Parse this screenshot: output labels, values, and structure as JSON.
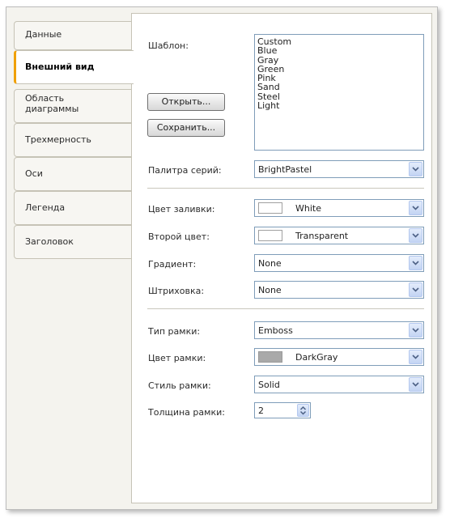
{
  "tabs": [
    {
      "label": "Данные"
    },
    {
      "label": "Внешний вид"
    },
    {
      "label": "Область диаграммы"
    },
    {
      "label": "Трехмерность"
    },
    {
      "label": "Оси"
    },
    {
      "label": "Легенда"
    },
    {
      "label": "Заголовок"
    }
  ],
  "active_tab": "Внешний вид",
  "template": {
    "label": "Шаблон:",
    "items": [
      "Custom",
      "Blue",
      "Gray",
      "Green",
      "Pink",
      "Sand",
      "Steel",
      "Light"
    ]
  },
  "buttons": {
    "open": "Открыть...",
    "save": "Сохранить..."
  },
  "fields": {
    "palette": {
      "label": "Палитра серий:",
      "value": "BrightPastel"
    },
    "fill_color": {
      "label": "Цвет заливки:",
      "value": "White",
      "swatch": "#ffffff"
    },
    "second_color": {
      "label": "Второй цвет:",
      "value": "Transparent",
      "swatch": "#ffffff"
    },
    "gradient": {
      "label": "Градиент:",
      "value": "None"
    },
    "hatching": {
      "label": "Штриховка:",
      "value": "None"
    },
    "border_type": {
      "label": "Тип рамки:",
      "value": "Emboss"
    },
    "border_color": {
      "label": "Цвет рамки:",
      "value": "DarkGray",
      "swatch": "#a9a9a9"
    },
    "border_style": {
      "label": "Стиль рамки:",
      "value": "Solid"
    },
    "border_width": {
      "label": "Толщина рамки:",
      "value": "2"
    }
  },
  "colors": {
    "active_tab_accent": "#f0a000",
    "control_border": "#7f9db9"
  }
}
